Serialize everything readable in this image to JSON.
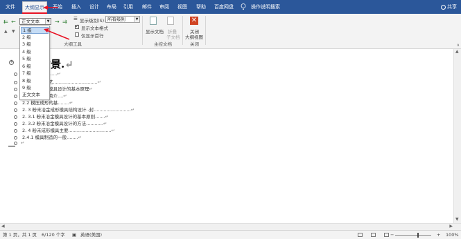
{
  "tabs": [
    {
      "label": "文件"
    },
    {
      "label": "大纲显示"
    },
    {
      "label": "开始"
    },
    {
      "label": "插入"
    },
    {
      "label": "设计"
    },
    {
      "label": "布局"
    },
    {
      "label": "引用"
    },
    {
      "label": "邮件"
    },
    {
      "label": "审阅"
    },
    {
      "label": "视图"
    },
    {
      "label": "帮助"
    },
    {
      "label": "百度网盘"
    }
  ],
  "tell_me": "操作说明搜索",
  "share": "共享",
  "ribbon": {
    "level_select_value": "正文文本",
    "show_level_label": "显示级别(S):",
    "show_level_value": "所有级别",
    "show_text_format": "显示文本格式",
    "show_first_line": "仅显示首行",
    "outline_tools_label": "大纲工具",
    "show_document": "显示文档",
    "collapse_subdoc": "折叠",
    "subdoc": "子文档",
    "master_doc_label": "主控文档",
    "close_label_1": "关闭",
    "close_label_2": "大纲视图",
    "close_group_label": "关闭",
    "accent_color": "#2b579a",
    "close_color": "#d04423"
  },
  "dropdown": {
    "items": [
      "1 级",
      "2 级",
      "3 级",
      "4 级",
      "5 级",
      "6 级",
      "7 级",
      "8 级",
      "9 级",
      "正文文本"
    ],
    "selected": "1 级"
  },
  "outline": {
    "heading": "背景.",
    "rows": [
      "......",
      "艺...............................",
      "模具设计的基本原理",
      "简介....",
      "2.2 模压成形的基........",
      "2. 3 粉末冶金成形模具结构设计..封..........................",
      "2. 3.1 粉末冶金模具设计的基本原则.......",
      "2. 3.2 粉末冶金模具设计的方法............",
      "2. 4 粉末成形模具主要..............................",
      "2.4.1 模具制造的一般........"
    ]
  },
  "status": {
    "page": "第 1 页，共 1 页",
    "words": "6/120 个字",
    "language": "英语(美国)",
    "zoom": "100%"
  }
}
